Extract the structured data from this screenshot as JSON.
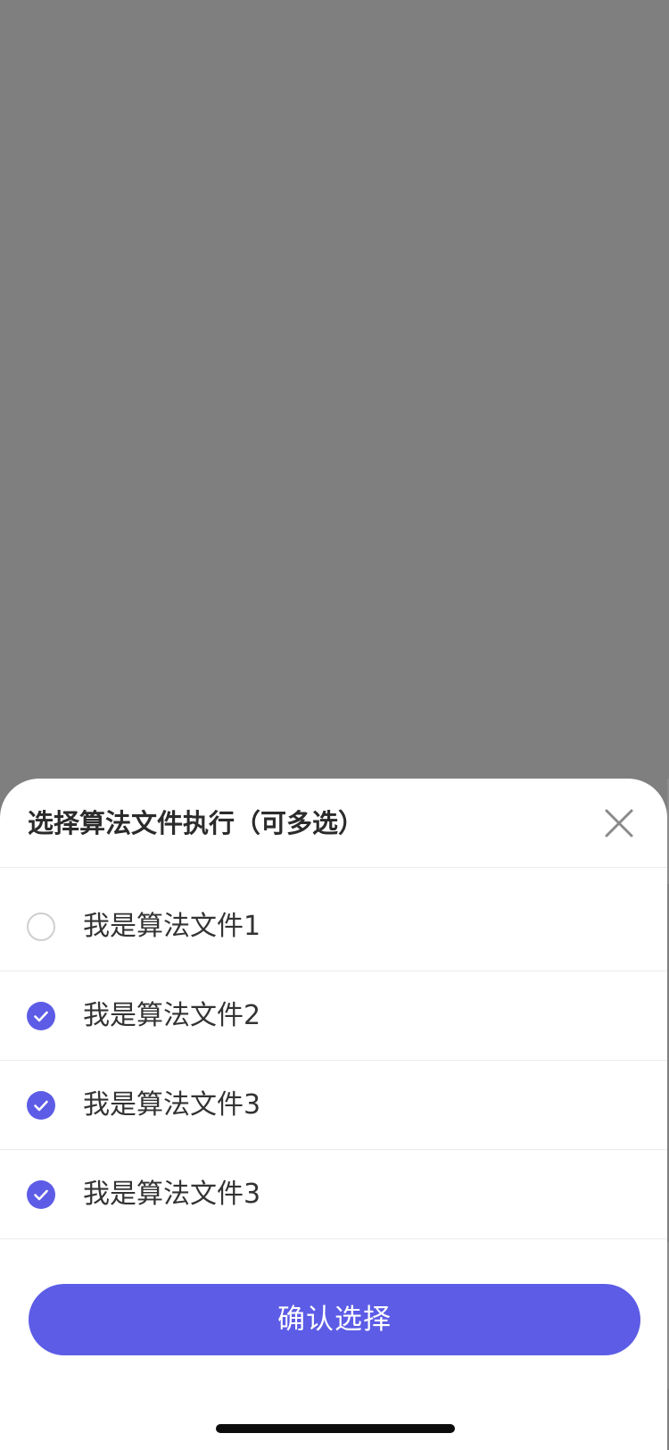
{
  "sheet": {
    "title": "选择算法文件执行（可多选）",
    "close_icon": "close-icon"
  },
  "options": [
    {
      "label": "我是算法文件1",
      "checked": false
    },
    {
      "label": "我是算法文件2",
      "checked": true
    },
    {
      "label": "我是算法文件3",
      "checked": true
    },
    {
      "label": "我是算法文件3",
      "checked": true
    }
  ],
  "confirm_label": "确认选择",
  "colors": {
    "accent": "#5c5ce6",
    "overlay": "#7f7f7f",
    "text": "#333333"
  }
}
